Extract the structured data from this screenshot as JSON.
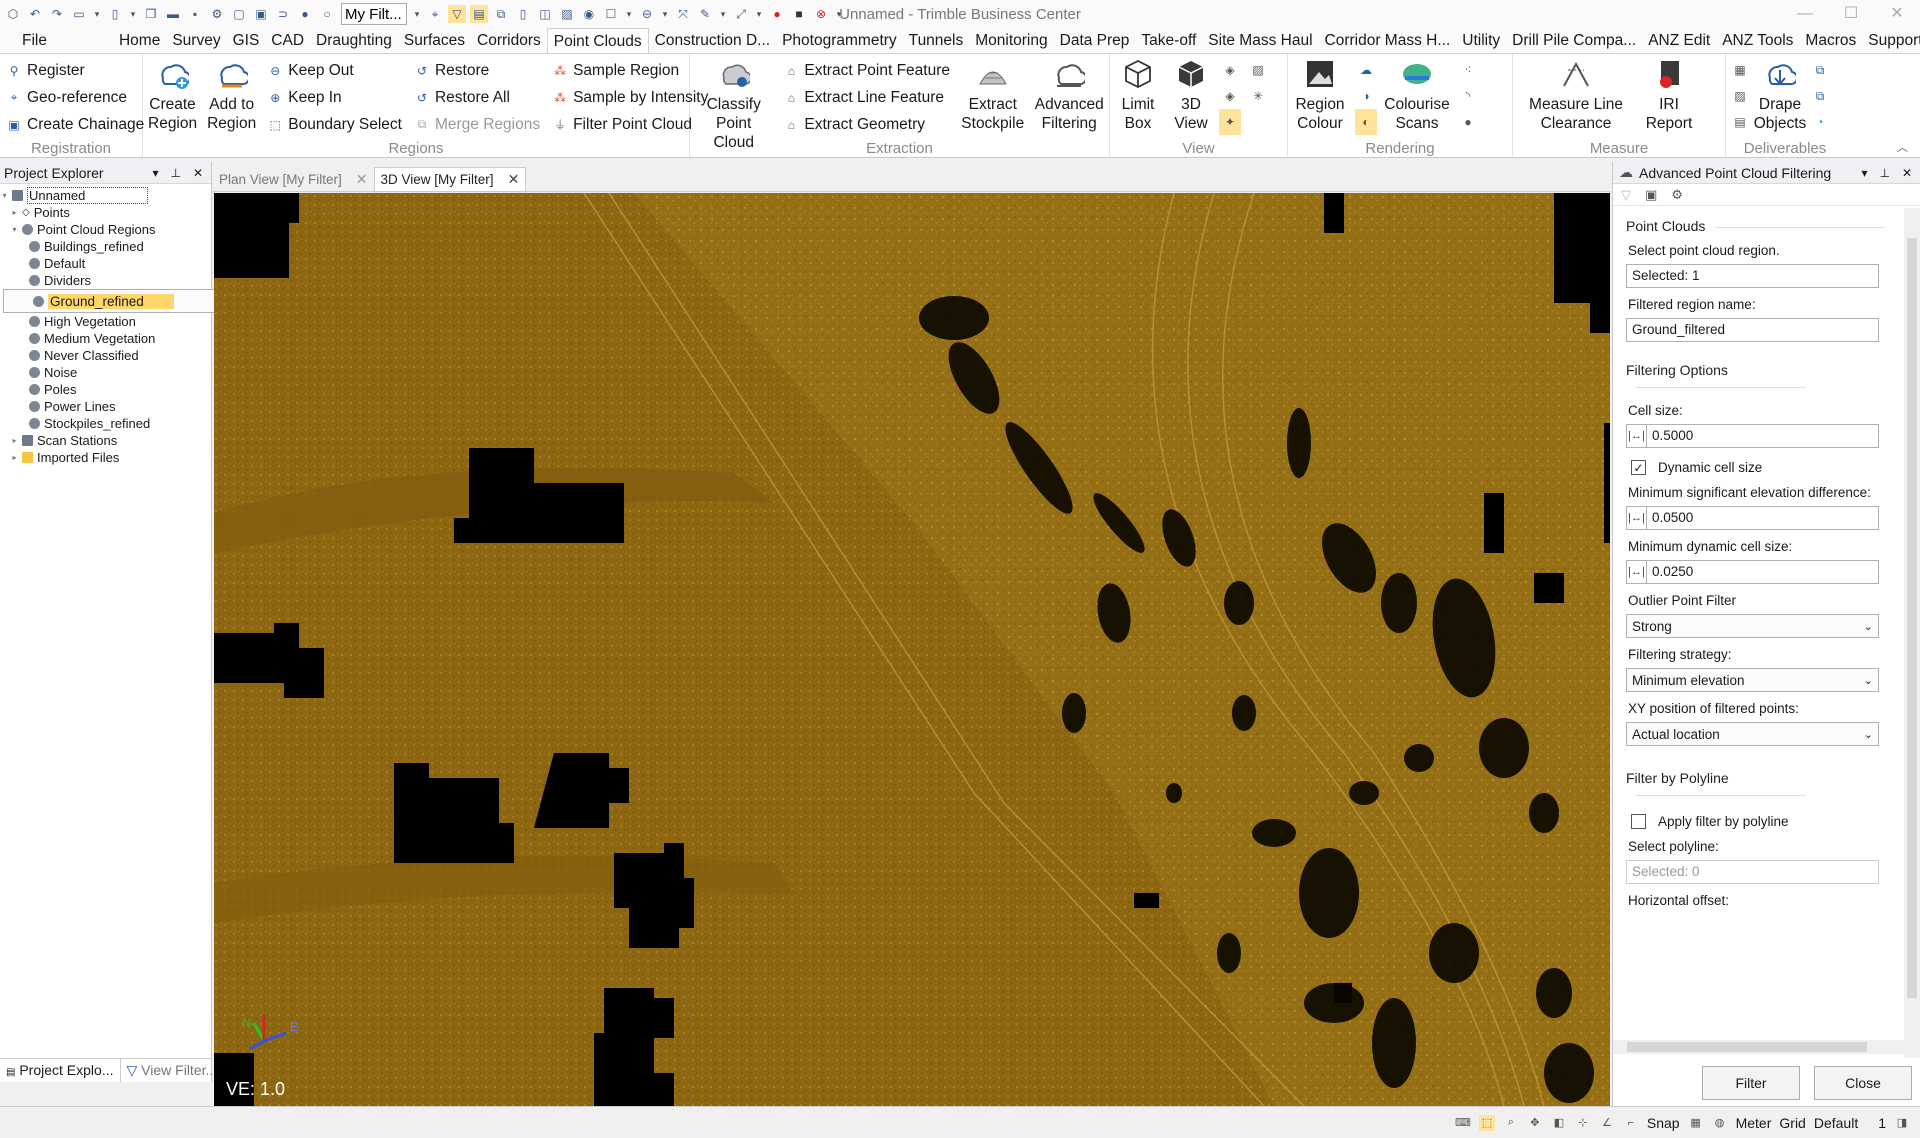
{
  "window": {
    "title": "Unnamed - Trimble Business Center",
    "filter_combo": "My Filt..."
  },
  "menu": {
    "file": "File",
    "items": [
      "Home",
      "Survey",
      "GIS",
      "CAD",
      "Draughting",
      "Surfaces",
      "Corridors",
      "Point Clouds",
      "Construction D...",
      "Photogrammetry",
      "Tunnels",
      "Monitoring",
      "Data Prep",
      "Take-off",
      "Site Mass Haul",
      "Corridor Mass H...",
      "Utility",
      "Drill Pile Compa...",
      "ANZ Edit",
      "ANZ Tools",
      "Macros",
      "Support"
    ],
    "active": "Point Clouds"
  },
  "ribbon": {
    "registration": {
      "label": "Registration",
      "register": "Register",
      "georef": "Geo-reference",
      "chainage": "Create Chainage"
    },
    "regions": {
      "label": "Regions",
      "create": "Create Region",
      "add": "Add to Region",
      "keep_out": "Keep Out",
      "keep_in": "Keep In",
      "boundary": "Boundary Select",
      "restore": "Restore",
      "restore_all": "Restore All",
      "merge": "Merge Regions",
      "sample": "Sample Region",
      "sample_int": "Sample by Intensity",
      "filter": "Filter Point Cloud"
    },
    "extraction": {
      "label": "Extraction",
      "classify": "Classify Point Cloud",
      "point_feat": "Extract Point Feature",
      "line_feat": "Extract Line Feature",
      "geometry": "Extract Geometry",
      "stockpile": "Extract Stockpile",
      "advanced": "Advanced Filtering"
    },
    "view": {
      "label": "View",
      "limit": "Limit Box",
      "view3d": "3D View"
    },
    "rendering": {
      "label": "Rendering",
      "region_colour": "Region Colour",
      "colourise": "Colourise Scans"
    },
    "measure": {
      "label": "Measure",
      "line_clear": "Measure Line Clearance",
      "iri": "IRI Report"
    },
    "deliverables": {
      "label": "Deliverables",
      "drape": "Drape Objects"
    }
  },
  "project_explorer": {
    "title": "Project Explorer",
    "root": "Unnamed",
    "points": "Points",
    "regions_folder": "Point Cloud Regions",
    "regions": [
      "Buildings_refined",
      "Default",
      "Dividers",
      "Ground_refined",
      "High Vegetation",
      "Medium Vegetation",
      "Never Classified",
      "Noise",
      "Poles",
      "Power Lines",
      "Stockpiles_refined"
    ],
    "selected": "Ground_refined",
    "scan_stations": "Scan Stations",
    "imported": "Imported Files",
    "tab_explorer": "Project Explo...",
    "tab_filter": "View Filter..."
  },
  "tabs": {
    "plan": "Plan View [My Filter]",
    "view3d": "3D View [My Filter]"
  },
  "viewport": {
    "ve": "VE: 1.0",
    "axis_n": "N",
    "axis_e": "E",
    "ground_color": "#8a6410"
  },
  "panel": {
    "title": "Advanced Point Cloud Filtering",
    "point_clouds": "Point Clouds",
    "select_region_label": "Select point cloud region.",
    "select_region_value": "Selected: 1",
    "filtered_name_label": "Filtered region name:",
    "filtered_name_value": "Ground_filtered",
    "filtering_options": "Filtering Options",
    "cell_size_label": "Cell size:",
    "cell_size_value": "0.5000",
    "dynamic_cell": "Dynamic cell size",
    "min_elev_label": "Minimum significant elevation difference:",
    "min_elev_value": "0.0500",
    "min_dyn_label": "Minimum dynamic cell size:",
    "min_dyn_value": "0.0250",
    "outlier_label": "Outlier Point Filter",
    "outlier_value": "Strong",
    "strategy_label": "Filtering strategy:",
    "strategy_value": "Minimum elevation",
    "xy_label": "XY position of filtered points:",
    "xy_value": "Actual location",
    "filter_polyline": "Filter by Polyline",
    "apply_polyline": "Apply filter by polyline",
    "select_polyline_label": "Select polyline:",
    "select_polyline_value": "Selected: 0",
    "horiz_offset_label": "Horizontal offset:",
    "filter_btn": "Filter",
    "close_btn": "Close"
  },
  "status": {
    "snap": "Snap",
    "units": "Meter",
    "grid": "Grid",
    "default": "Default",
    "count": "1"
  }
}
